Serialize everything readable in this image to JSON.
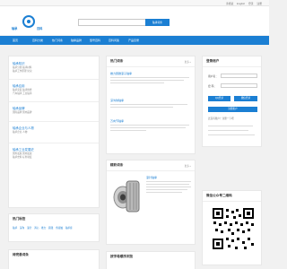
{
  "topbar": {
    "links": [
      "手机版",
      "English",
      "登录",
      "注册"
    ]
  },
  "brand": {
    "logo_left": "轴承",
    "logo_right": "百科"
  },
  "search": {
    "placeholder": "",
    "button_label": "轴承词条"
  },
  "nav": {
    "items": [
      "首页",
      "百科分类",
      "热门词条",
      "轴承品牌",
      "型号百科",
      "百科问答",
      "产品目录"
    ]
  },
  "sidebar": {
    "sections": [
      {
        "title": "轴承知识",
        "lines": [
          "轴承分类 轴承材料",
          "轴承工作原理 常识"
        ]
      },
      {
        "title": "轴承应用",
        "lines": [
          "轴承安装 轴承维修",
          "汽车轴承 工业轴承"
        ]
      },
      {
        "title": "轴承品牌",
        "lines": [
          "国际品牌 国内品牌"
        ]
      },
      {
        "title": "轴承企业与人物",
        "lines": [
          "轴承企业 人物"
        ]
      },
      {
        "title": "轴承工业发展史",
        "lines": [
          "国外发展 国内发展",
          "轴承史料 标准制度"
        ]
      }
    ]
  },
  "hot": {
    "title": "热门词条",
    "more": "更多 »",
    "items": [
      {
        "title": "推力圆锥滚子轴承"
      },
      {
        "title": "深沟球轴承"
      },
      {
        "title": "万向节轴承"
      }
    ]
  },
  "featured": {
    "title": "精彩词条",
    "more": "更多 »",
    "item_title": "滚针轴承"
  },
  "login": {
    "title": "登录用户",
    "username_label": "用户名：",
    "password_label": "密 码：",
    "buttons": [
      "QQ登录",
      "微信登录",
      "注册账户"
    ],
    "register_text": "还没有账户？注册一下吧"
  },
  "qr": {
    "title": "微信公众号二维码"
  },
  "hot_tags": {
    "title": "热门标签",
    "tags": [
      "轴承",
      "深沟",
      "滚针",
      "调心",
      "推力",
      "圆锥",
      "角接触",
      "轴承座"
    ]
  },
  "recommend": {
    "title": "待完善词条"
  },
  "bottom": {
    "title": "按字母顺序浏览"
  }
}
